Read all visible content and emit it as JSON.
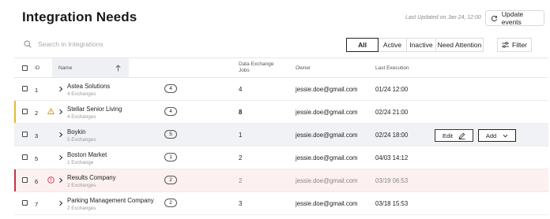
{
  "header": {
    "title": "Integration Needs",
    "last_updated": "Last Updated on Jan 24, 12:00",
    "update_button": "Update events"
  },
  "search": {
    "placeholder": "Search in Integrations"
  },
  "filters": {
    "options": [
      "All",
      "Active",
      "Inactive",
      "Need Attention"
    ],
    "selected": "All",
    "filter_button": "Filter"
  },
  "table": {
    "columns": {
      "id": "ID",
      "name": "Name",
      "jobs_line1": "Data Exchange",
      "jobs_line2": "Jobs",
      "owner": "Owner",
      "last_execution": "Last Execution"
    },
    "rows": [
      {
        "id": "1",
        "name": "Astea Solutions",
        "exchanges": "4 Exchanges",
        "badge": "4",
        "jobs": "4",
        "owner": "jessie.doe@gmail.com",
        "last_execution": "01/24 12:00"
      },
      {
        "id": "2",
        "name": "Stellar Senior Living",
        "exchanges": "4 Exchanges",
        "badge": "4",
        "jobs": "8",
        "owner": "jessie.doe@gmail.com",
        "last_execution": "02/24 21:00",
        "status": "warning"
      },
      {
        "id": "3",
        "name": "Boykin",
        "exchanges": "5 Exchanges",
        "badge": "5",
        "jobs": "1",
        "owner": "jessie.doe@gmail.com",
        "last_execution": "02/24 18:00",
        "edit_label": "Edit",
        "add_label": "Add"
      },
      {
        "id": "5",
        "name": "Boston Market",
        "exchanges": "1 Exchange",
        "badge": "1",
        "jobs": "2",
        "owner": "jessie.doe@gmail.com",
        "last_execution": "04/03 14:12"
      },
      {
        "id": "6",
        "name": "Results Company",
        "exchanges": "2 Exchanges",
        "badge": "2",
        "jobs": "2",
        "owner": "jessie.doe@gmail.com",
        "last_execution": "03/19 06:53",
        "status": "error"
      },
      {
        "id": "7",
        "name": "Parking Management Company",
        "exchanges": "2 Exchanges",
        "badge": "2",
        "jobs": "3",
        "owner": "jessie.doe@gmail.com",
        "last_execution": "03/18 15:53"
      }
    ]
  },
  "colors": {
    "warning": "#e8b931",
    "warning_text": "#c9820f",
    "error": "#c8324a",
    "hover_row": "#f1f2f5",
    "error_row": "#fdf0f0"
  },
  "icons": {
    "refresh": "refresh-icon",
    "search": "search-icon",
    "filter": "sliders-icon",
    "sort": "arrow-up-icon",
    "expand": "chevron-right-icon",
    "warning": "warning-triangle-icon",
    "error": "error-circle-icon",
    "edit": "pencil-icon",
    "add_dropdown": "chevron-down-icon"
  }
}
